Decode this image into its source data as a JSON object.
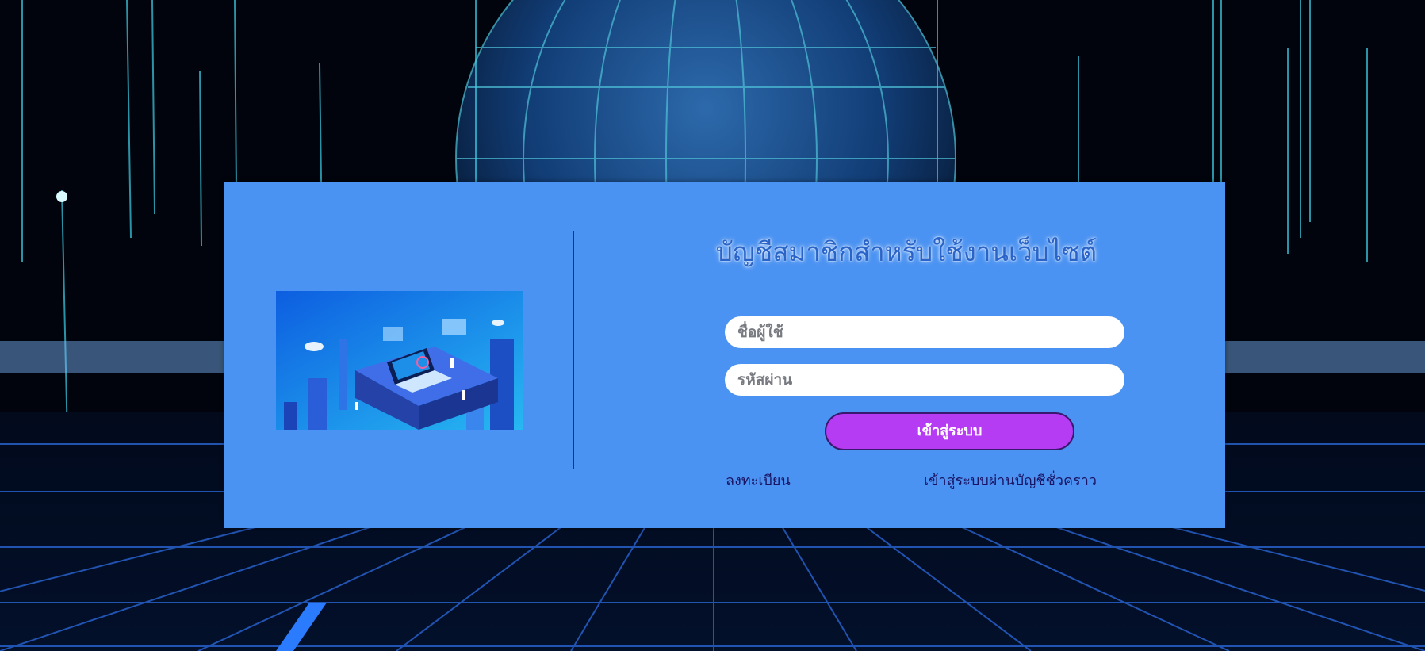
{
  "login_panel": {
    "title": "บัญชีสมาชิกสำหรับใช้งานเว็บไซต์",
    "username_placeholder": "ชื่อผู้ใช้",
    "password_placeholder": "รหัสผ่าน",
    "login_button_label": "เข้าสู่ระบบ",
    "register_link": "ลงทะเบียน",
    "guest_login_link": "เข้าสู่ระบบผ่านบัญชีชั่วคราว"
  },
  "colors": {
    "panel_background": "#4b93f2",
    "title_color": "#2a64c9",
    "button_color": "#b53cf2",
    "link_color": "#1a1464"
  }
}
